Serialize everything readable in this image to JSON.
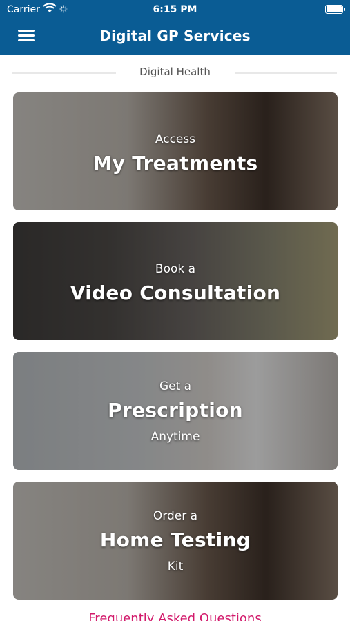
{
  "status_bar": {
    "carrier": "Carrier",
    "time": "6:15 PM"
  },
  "header": {
    "title": "Digital GP Services",
    "menu_icon": "hamburger-menu-icon"
  },
  "section": {
    "label": "Digital Health"
  },
  "cards": [
    {
      "small": "Access",
      "big": "My Treatments",
      "sub": ""
    },
    {
      "small": "Book a",
      "big": "Video Consultation",
      "sub": ""
    },
    {
      "small": "Get a",
      "big": "Prescription",
      "sub": "Anytime"
    },
    {
      "small": "Order a",
      "big": "Home Testing",
      "sub": "Kit"
    }
  ],
  "faq": {
    "label": "Frequently Asked Questions"
  },
  "colors": {
    "header": "#0a5c94",
    "faq": "#d21a6b"
  }
}
